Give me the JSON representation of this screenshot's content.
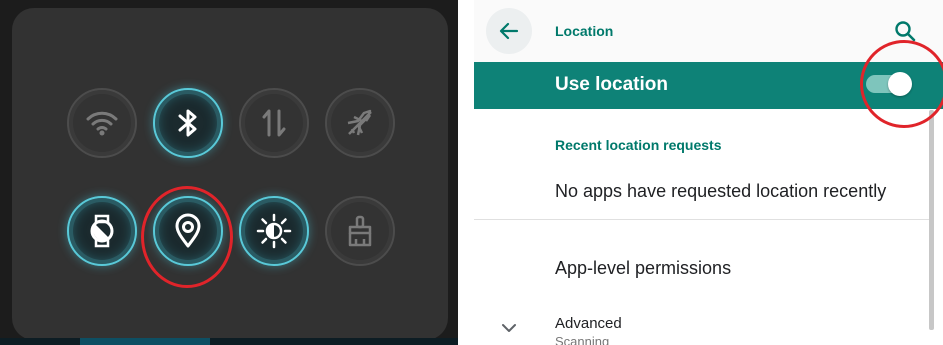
{
  "quick_settings": {
    "tiles": [
      {
        "name": "wifi-icon",
        "state": "off"
      },
      {
        "name": "bluetooth-icon",
        "state": "on"
      },
      {
        "name": "mobile-data-icon",
        "state": "off"
      },
      {
        "name": "airplane-mode-icon",
        "state": "off"
      },
      {
        "name": "watch-face-icon",
        "state": "on"
      },
      {
        "name": "location-icon",
        "state": "on"
      },
      {
        "name": "brightness-icon",
        "state": "on"
      },
      {
        "name": "clean-brush-icon",
        "state": "off"
      }
    ],
    "colors": {
      "panel": "#323232",
      "active": "#59c9d8",
      "highlight": "#e0242a"
    }
  },
  "location_settings": {
    "title": "Location",
    "back_icon": "arrow-left-icon",
    "search_icon": "search-icon",
    "master_switch": {
      "label": "Use location",
      "state": "on"
    },
    "recent_header": "Recent location requests",
    "recent_empty": "No apps have requested location recently",
    "app_permissions": "App-level permissions",
    "advanced": {
      "title": "Advanced",
      "subtitle": "Scanning",
      "icon": "chevron-down-icon"
    },
    "colors": {
      "accent": "#00796b",
      "bar": "#0e8277"
    }
  }
}
